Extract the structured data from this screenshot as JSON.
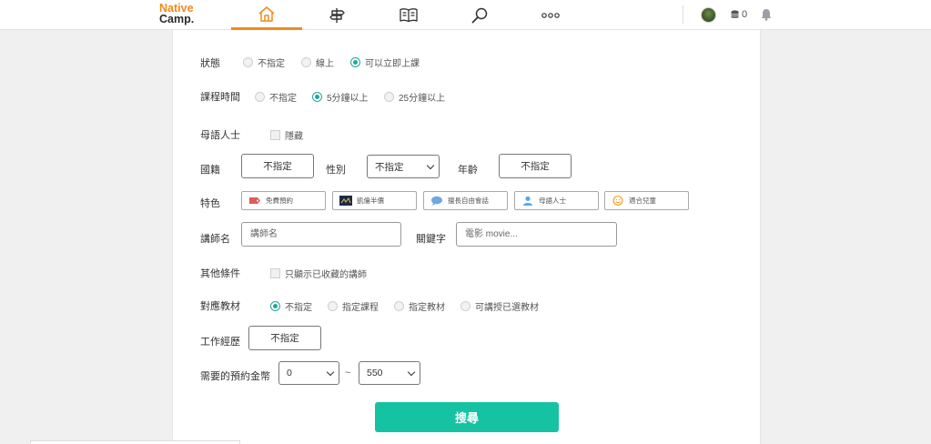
{
  "header": {
    "logo_line1": "Native",
    "logo_line2": "Camp.",
    "nav": [
      {
        "icon": "home-icon",
        "active": true
      },
      {
        "icon": "signpost-icon",
        "active": false
      },
      {
        "icon": "book-icon",
        "active": false
      },
      {
        "icon": "search-icon",
        "active": false
      },
      {
        "icon": "more-icon",
        "active": false
      }
    ],
    "coin_count": "0"
  },
  "filters": {
    "status": {
      "label": "狀態",
      "options": [
        "不指定",
        "線上",
        "可以立即上課"
      ],
      "selected": "可以立即上課"
    },
    "course_time": {
      "label": "課程時間",
      "options": [
        "不指定",
        "5分鐘以上",
        "25分鐘以上"
      ],
      "selected": "5分鐘以上"
    },
    "native": {
      "label": "母語人士",
      "checkbox_label": "隱藏"
    },
    "nationality": {
      "label": "國籍",
      "value": "不指定"
    },
    "gender": {
      "label": "性別",
      "value": "不指定"
    },
    "age": {
      "label": "年齡",
      "value": "不指定"
    },
    "features": {
      "label": "特色",
      "items": [
        {
          "label": "免費預約",
          "icon": "coupon-icon",
          "color": "#e05a5a"
        },
        {
          "label": "凱倫半價",
          "icon": "teacher-photo-icon",
          "color": "#1c2b4a"
        },
        {
          "label": "擅長自由會話",
          "icon": "chat-bubble-icon",
          "color": "#6ea8e0"
        },
        {
          "label": "母語人士",
          "icon": "person-icon",
          "color": "#5aa8e6"
        },
        {
          "label": "適合兒童",
          "icon": "smile-icon",
          "color": "#f0a020"
        }
      ]
    },
    "teacher_name": {
      "label": "講師名",
      "placeholder": "講師名"
    },
    "keyword": {
      "label": "關鍵字",
      "placeholder": "電影 movie..."
    },
    "other": {
      "label": "其他條件",
      "checkbox_label": "只顯示已收藏的講師"
    },
    "material": {
      "label": "對應教材",
      "options": [
        "不指定",
        "指定課程",
        "指定教材",
        "可講授已選教材"
      ],
      "selected": "不指定"
    },
    "experience": {
      "label": "工作經歷",
      "value": "不指定"
    },
    "coins": {
      "label": "需要的預約金幣",
      "min": "0",
      "separator": "~",
      "max": "550"
    }
  },
  "search_button": "搜尋",
  "colors": {
    "accent": "#f08a1c",
    "primary": "#15c3a3",
    "radio_on": "#23a79b"
  }
}
